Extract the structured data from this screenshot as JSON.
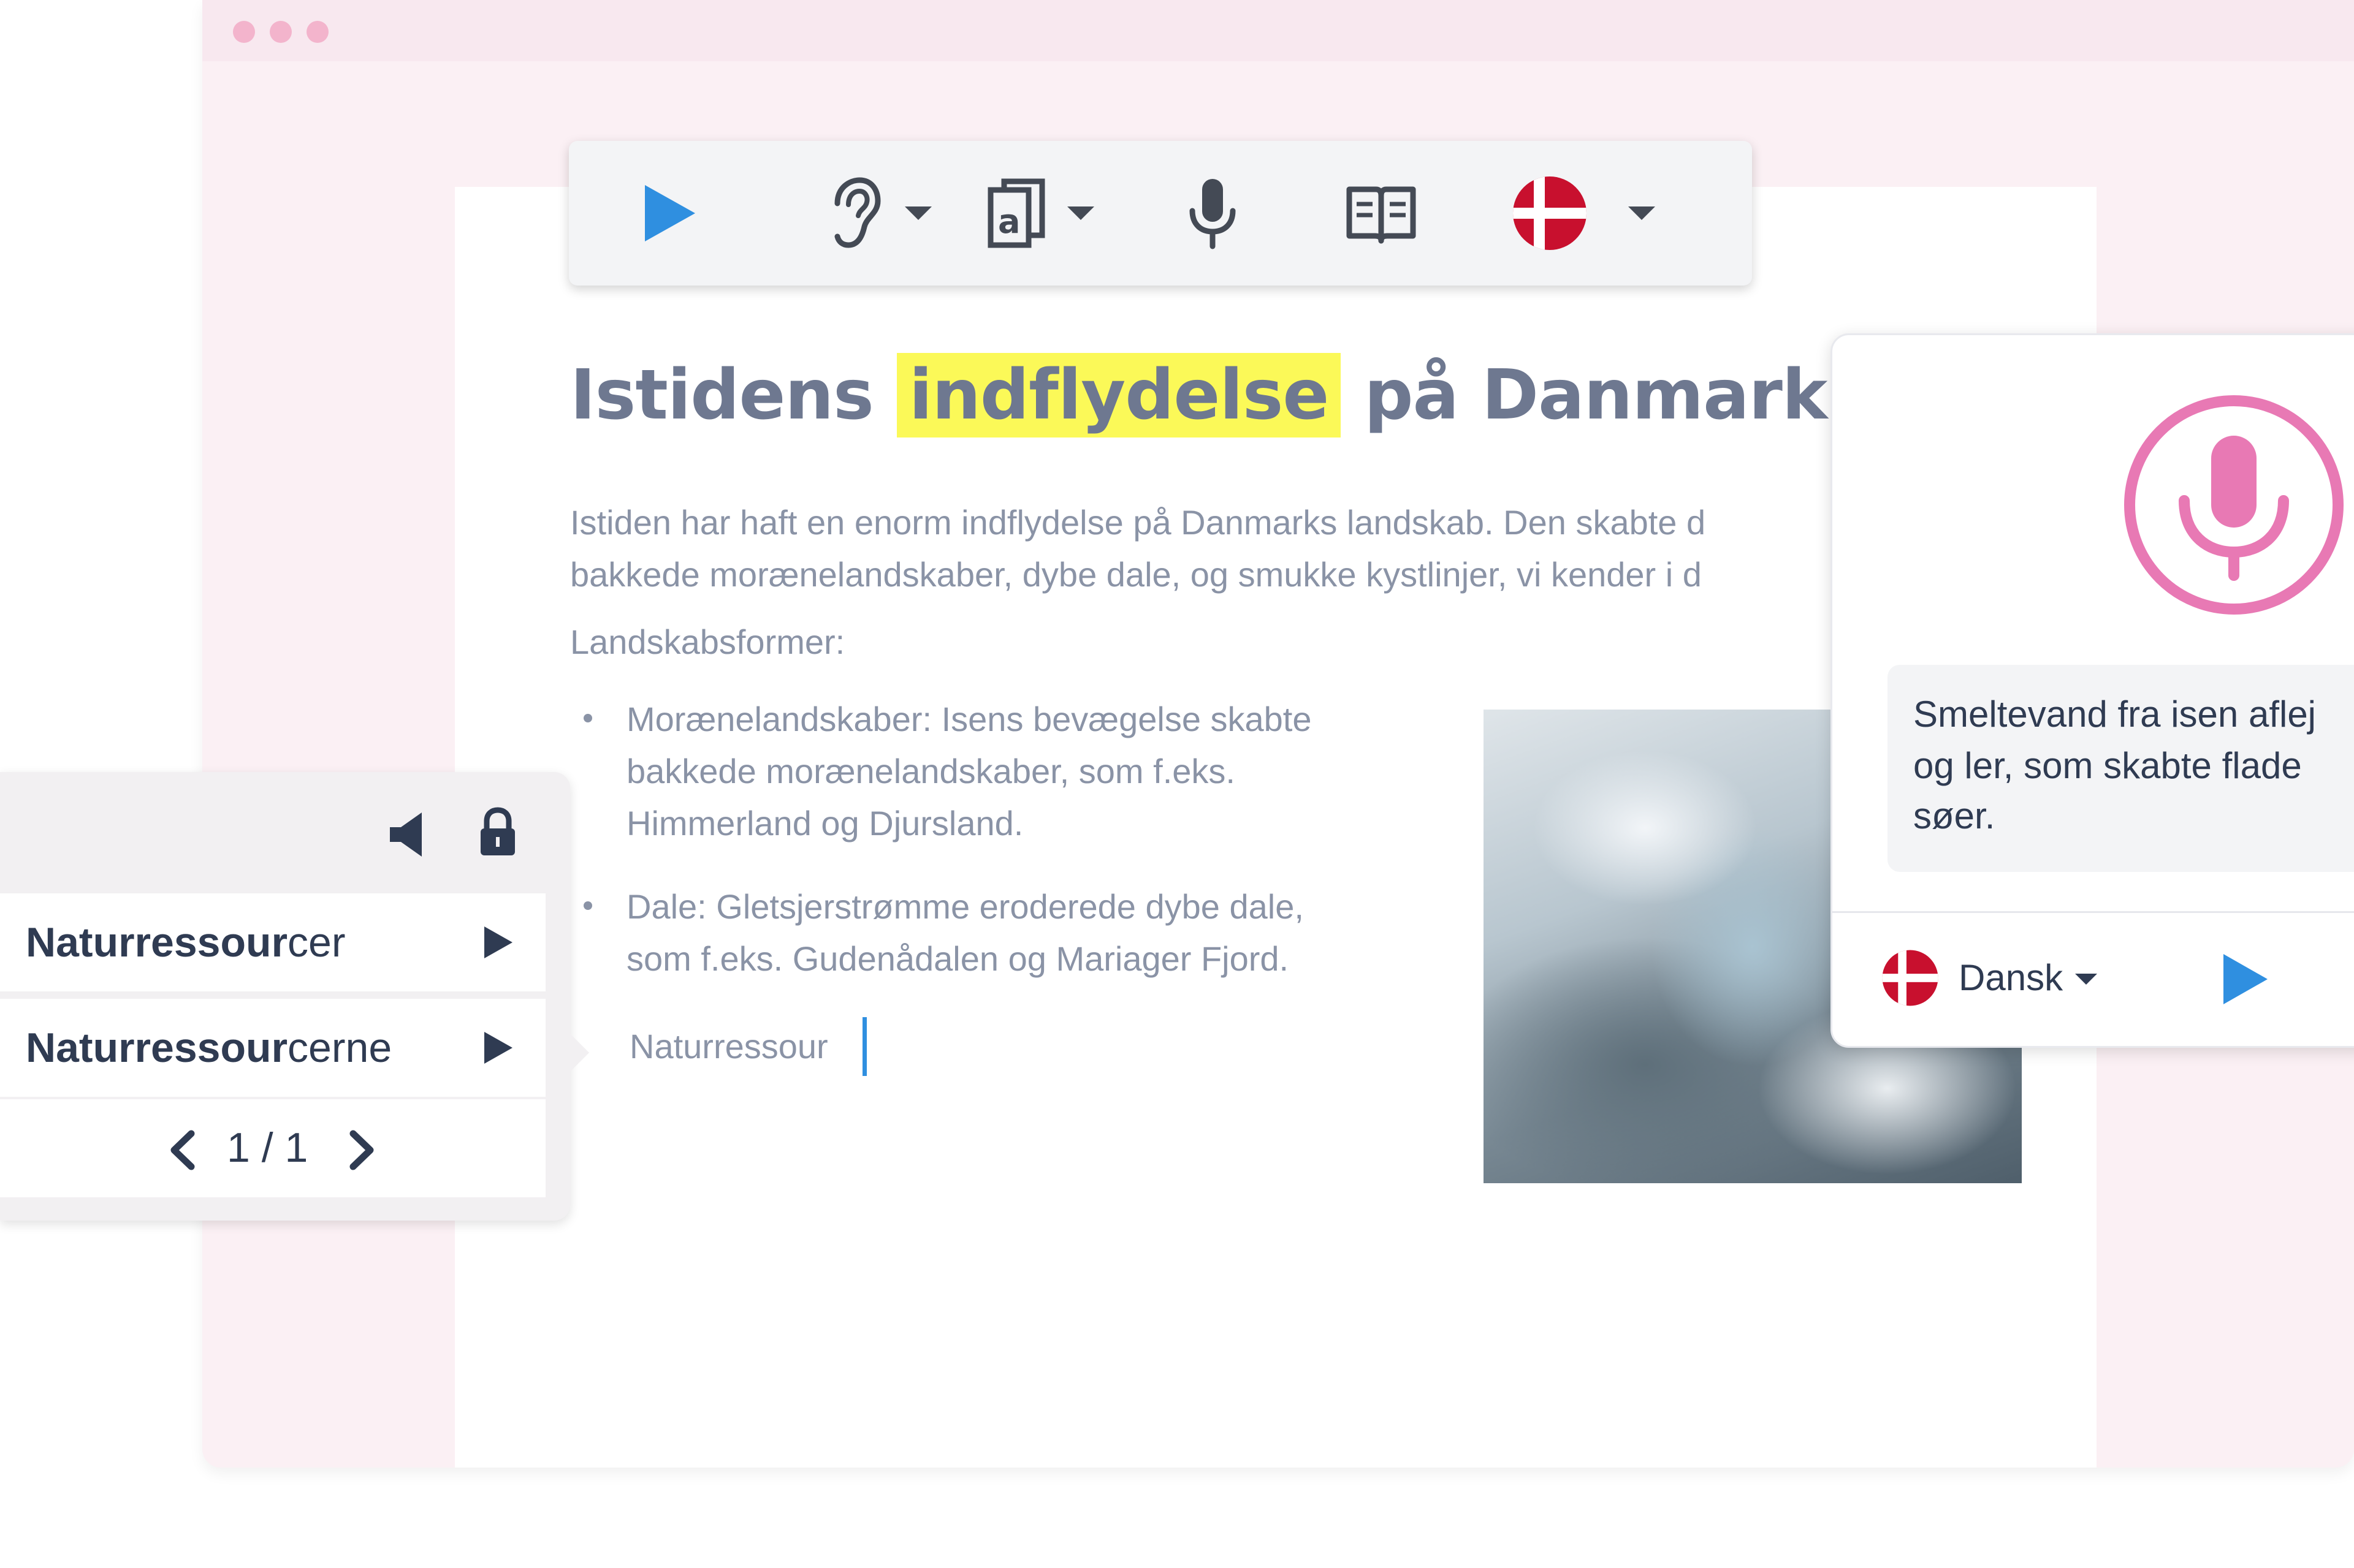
{
  "toolbar": {
    "items": [
      "play-icon",
      "ear-icon",
      "text-box-icon",
      "microphone-icon",
      "book-icon",
      "danish-flag-icon"
    ],
    "accent_color": "#2f8fe0"
  },
  "document": {
    "title_before": "Istidens",
    "title_highlight": "indflydelse",
    "title_after": "på Danmark",
    "highlight_color": "#fbf958",
    "paragraph_line1": "Istiden har haft en enorm indflydelse på Danmarks landskab. Den skabte d",
    "paragraph_line2": "bakkede morænelandskaber, dybe dale, og smukke kystlinjer, vi kender i d",
    "subheading": "Landskabsformer:",
    "bullet1_line1": "Morænelandskaber: Isens bevægelse skabte",
    "bullet1_line2": "bakkede morænelandskaber, som f.eks.",
    "bullet1_line3": "Himmerland og Djursland.",
    "bullet2_line1": "Dale: Gletsjerstrømme eroderede dybe dale,",
    "bullet2_line2": "som f.eks. Gudenådalen og Mariager Fjord.",
    "typing_text": "Naturressour"
  },
  "prediction": {
    "header_icons": [
      "speaker-icon",
      "lock-icon"
    ],
    "items": [
      {
        "bold": "Naturressour",
        "rest": "cer"
      },
      {
        "bold": "Naturressour",
        "rest": "cerne"
      }
    ],
    "page": "1 / 1"
  },
  "speech": {
    "mic_color": "#e879b4",
    "line1": "Smeltevand fra isen aflej",
    "line2": "og ler, som skabte flade",
    "line3": "søer.",
    "language": "Dansk"
  }
}
